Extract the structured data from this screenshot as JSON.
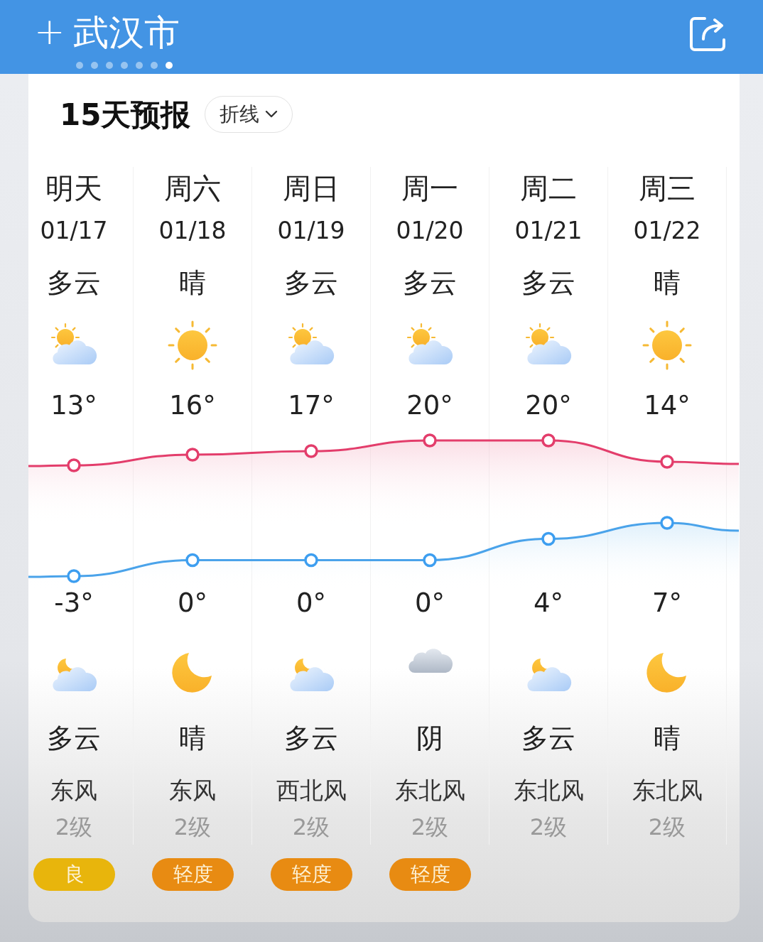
{
  "header": {
    "add": "+",
    "city": "武汉市",
    "page_dots": [
      {
        "selected": false
      },
      {
        "selected": false
      },
      {
        "selected": false
      },
      {
        "selected": false
      },
      {
        "selected": false
      },
      {
        "selected": false
      },
      {
        "selected": true
      }
    ]
  },
  "forecast": {
    "title": "15天预报",
    "view_menu": "折线",
    "days": [
      {
        "name": "明天",
        "date": "01/17",
        "day": {
          "condition": "多云",
          "kind": "partly_cloudy",
          "high": "13°"
        },
        "night": {
          "low": "-3°",
          "kind": "partly_cloudy_night",
          "condition": "多云"
        },
        "wind": "东风",
        "wind_level": "2级",
        "aqi": {
          "label": "良",
          "color": "#e8b50c"
        }
      },
      {
        "name": "周六",
        "date": "01/18",
        "day": {
          "condition": "晴",
          "kind": "sunny",
          "high": "16°"
        },
        "night": {
          "low": "0°",
          "kind": "clear_night",
          "condition": "晴"
        },
        "wind": "东风",
        "wind_level": "2级",
        "aqi": {
          "label": "轻度",
          "color": "#e88b12"
        }
      },
      {
        "name": "周日",
        "date": "01/19",
        "day": {
          "condition": "多云",
          "kind": "partly_cloudy",
          "high": "17°"
        },
        "night": {
          "low": "0°",
          "kind": "partly_cloudy_night",
          "condition": "多云"
        },
        "wind": "西北风",
        "wind_level": "2级",
        "aqi": {
          "label": "轻度",
          "color": "#e88b12"
        }
      },
      {
        "name": "周一",
        "date": "01/20",
        "day": {
          "condition": "多云",
          "kind": "partly_cloudy",
          "high": "20°"
        },
        "night": {
          "low": "0°",
          "kind": "overcast",
          "condition": "阴"
        },
        "wind": "东北风",
        "wind_level": "2级",
        "aqi": {
          "label": "轻度",
          "color": "#e88b12"
        }
      },
      {
        "name": "周二",
        "date": "01/21",
        "day": {
          "condition": "多云",
          "kind": "partly_cloudy",
          "high": "20°"
        },
        "night": {
          "low": "4°",
          "kind": "partly_cloudy_night",
          "condition": "多云"
        },
        "wind": "东北风",
        "wind_level": "2级"
      },
      {
        "name": "周三",
        "date": "01/22",
        "day": {
          "condition": "晴",
          "kind": "sunny",
          "high": "14°"
        },
        "night": {
          "low": "7°",
          "kind": "clear_night",
          "condition": "晴"
        },
        "wind": "东北风",
        "wind_level": "2级"
      }
    ]
  }
}
